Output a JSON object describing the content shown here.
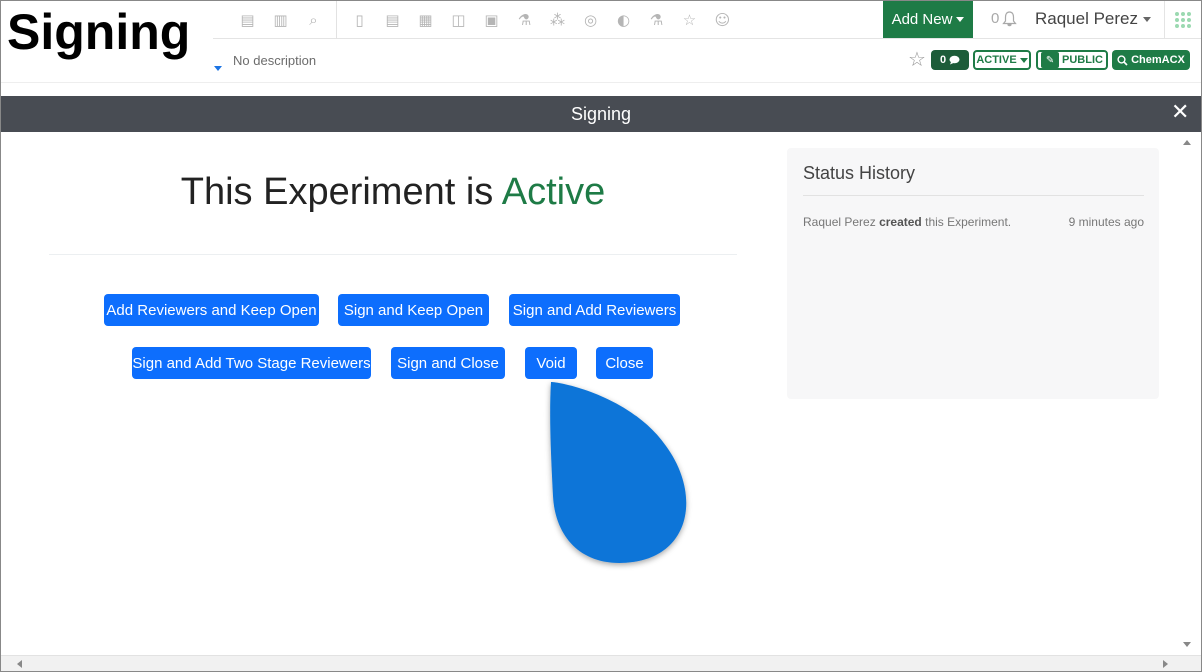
{
  "tutorial_title": "Signing",
  "nav": {
    "icons": [
      "dashboard-icon",
      "chart-icon",
      "search-icon",
      "notebook-icon",
      "clipboard-icon",
      "calendar-icon",
      "presentation-icon",
      "clipboard-check-icon",
      "lab-icon",
      "molecule-icon",
      "registration-icon",
      "database-icon",
      "flask-icon",
      "favorites-icon",
      "user-icon"
    ],
    "icon_glyphs": [
      "▤",
      "▥",
      "⌕",
      "▯",
      "▤",
      "▦",
      "◫",
      "▣",
      "⚗",
      "⁂",
      "◎",
      "◐",
      "⚗",
      "☆",
      "☺"
    ],
    "add_new_label": "Add New",
    "notification_count": "0",
    "user_name": "Raquel Perez",
    "accent_color": "#1e7b46"
  },
  "description": {
    "text": "No description"
  },
  "badges": {
    "comments_count": "0",
    "status_label": "ACTIVE",
    "visibility_label": "PUBLIC",
    "chemacx_label": "ChemACX"
  },
  "modal": {
    "title": "Signing",
    "close_glyph": "✕",
    "headline_prefix": "This Experiment is",
    "headline_status": "Active",
    "buttons": {
      "add_reviewers_keep_open": "Add Reviewers and Keep Open",
      "sign_keep_open": "Sign and Keep Open",
      "sign_add_reviewers": "Sign and Add Reviewers",
      "sign_add_two_stage": "Sign and Add Two Stage Reviewers",
      "sign_close": "Sign and Close",
      "void": "Void",
      "close": "Close"
    },
    "button_color": "#0d6efd"
  },
  "status_history": {
    "title": "Status History",
    "entry_user": "Raquel Perez",
    "entry_action": "created",
    "entry_object": "this Experiment.",
    "entry_time": "9 minutes ago"
  }
}
